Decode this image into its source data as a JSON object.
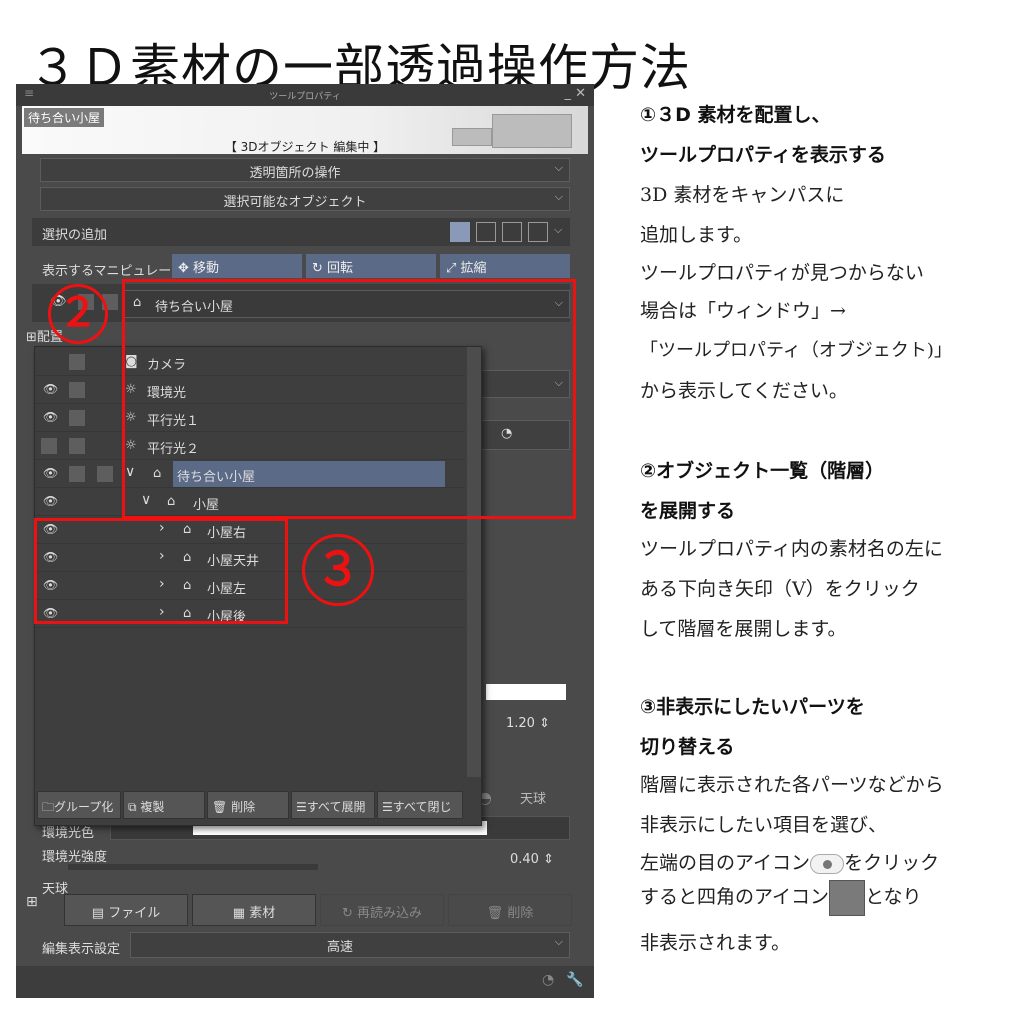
{
  "page_title": "３Ｄ素材の一部透過操作方法",
  "panel": {
    "title": "ツールプロパティ",
    "window_controls": "_ ✕",
    "banner_tag": "待ち合い小屋",
    "banner_label": "【 3Dオブジェクト 編集中 】",
    "dropdown_transparent": "透明箇所の操作",
    "dropdown_selectable": "選択可能なオブジェクト",
    "add_selection_label": "選択の追加",
    "manipulator_label": "表示するマニピュレータ",
    "manip_buttons": [
      "移動",
      "回転",
      "拡縮"
    ],
    "object_dropdown": "待ち合い小屋",
    "layout_label": "配置",
    "tree": [
      {
        "label": "カメラ",
        "eye": ""
      },
      {
        "label": "環境光",
        "eye": "👁"
      },
      {
        "label": "平行光１",
        "eye": "👁"
      },
      {
        "label": "平行光２",
        "eye": ""
      },
      {
        "label": "待ち合い小屋",
        "eye": "👁"
      },
      {
        "label": "小屋",
        "eye": "👁"
      },
      {
        "label": "小屋右",
        "eye": "👁"
      },
      {
        "label": "小屋天井",
        "eye": "👁"
      },
      {
        "label": "小屋左",
        "eye": "👁"
      },
      {
        "label": "小屋後",
        "eye": "👁"
      }
    ],
    "tree_buttons": [
      "グループ化",
      "複製",
      "削除",
      "すべて展開",
      "すべて閉じ"
    ],
    "value_120": "1.20",
    "sky_label": "天球",
    "ambient_color_label": "環境光色",
    "ambient_strength_label": "環境光強度",
    "ambient_strength_value": "0.40",
    "sky_section": "天球",
    "bottom_buttons": [
      "ファイル",
      "素材",
      "再読み込み",
      "削除"
    ],
    "edit_display_label": "編集表示設定",
    "edit_display_value": "高速"
  },
  "callouts": [
    "２",
    "３"
  ],
  "instructions": {
    "step1_heading_a": "①３D 素材を配置し、",
    "step1_heading_b": "ツールプロパティを表示する",
    "step1_lines": [
      "3D 素材をキャンパスに",
      "追加します。",
      "ツールプロパティが見つからない",
      "場合は「ウィンドウ」→",
      "「ツールプロパティ（オブジェクト)」",
      "から表示してください。"
    ],
    "step2_heading_a": "②オブジェクト一覧（階層）",
    "step2_heading_b": "を展開する",
    "step2_lines": [
      "ツールプロパティ内の素材名の左に",
      "ある下向き矢印（V）をクリック",
      "して階層を展開します。"
    ],
    "step3_heading_a": "③非表示にしたいパーツを",
    "step3_heading_b": "切り替える",
    "step3_lines": [
      "階層に表示された各パーツなどから",
      "非表示にしたい項目を選び、"
    ],
    "step3_line_eye_a": "左端の目のアイコン",
    "step3_line_eye_b": "をクリック",
    "step3_line_sq_a": "すると四角のアイコン",
    "step3_line_sq_b": "となり",
    "step3_last": "非表示されます。"
  },
  "colors": {
    "accent_red": "#e11111",
    "button_blue": "#5b6a86"
  }
}
